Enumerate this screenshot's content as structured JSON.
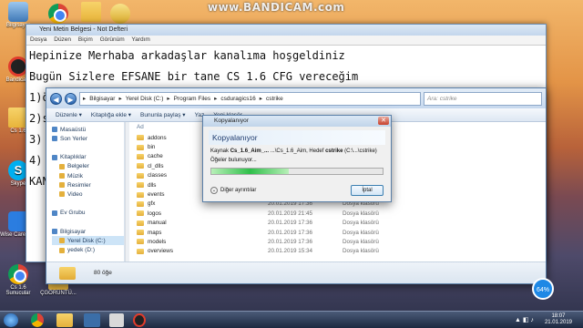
{
  "watermark": "www.BANDICAM.com",
  "desktop_icons": [
    {
      "label": "Bilgisayar"
    },
    {
      "label": "Bandica..."
    },
    {
      "label": "Cs 1.6"
    },
    {
      "label": "Skype"
    },
    {
      "label": "Wise Care 365"
    },
    {
      "label": "Cs 1.6 Sunucular"
    }
  ],
  "bottom_desk_label": "ÇGÖRÜNTÜ...",
  "notepad": {
    "title": "Yeni Metin Belgesi - Not Defteri",
    "menu": [
      "Dosya",
      "Düzen",
      "Biçim",
      "Görünüm",
      "Yardım"
    ],
    "lines": [
      "Hepinize Merhaba arkadaşlar kanalıma hoşgeldiniz",
      "",
      "Bugün Sizlere EFSANE bir tane CS 1.6 CFG vereceğim",
      "",
      "1)ö",
      "2)s",
      "3)",
      "4)",
      "",
      "KAN"
    ]
  },
  "explorer": {
    "breadcrumb": [
      "Bilgisayar",
      "Yerel Disk (C:)",
      "Program Files",
      "csduragics16",
      "cstrike"
    ],
    "search_placeholder": "Ara: cstrike",
    "toolbar": [
      "Düzenle ▾",
      "Kitaplığa ekle ▾",
      "Bununla paylaş ▾",
      "Yaz",
      "Yeni klasör"
    ],
    "nav": [
      {
        "label": "Masaüstü",
        "sub": false
      },
      {
        "label": "Son Yerler",
        "sub": false
      },
      {
        "label": "",
        "sub": false
      },
      {
        "label": "Kitaplıklar",
        "sub": false
      },
      {
        "label": "Belgeler",
        "sub": true
      },
      {
        "label": "Müzik",
        "sub": true
      },
      {
        "label": "Resimler",
        "sub": true
      },
      {
        "label": "Video",
        "sub": true
      },
      {
        "label": "",
        "sub": false
      },
      {
        "label": "Ev Grubu",
        "sub": false
      },
      {
        "label": "",
        "sub": false
      },
      {
        "label": "Bilgisayar",
        "sub": false
      },
      {
        "label": "Yerel Disk (C:)",
        "sub": true
      },
      {
        "label": "yedek (D:)",
        "sub": true
      }
    ],
    "column_header": "Ad",
    "files": [
      {
        "name": "addons",
        "date": "",
        "type": ""
      },
      {
        "name": "bin",
        "date": "",
        "type": ""
      },
      {
        "name": "cache",
        "date": "",
        "type": ""
      },
      {
        "name": "cl_dlls",
        "date": "",
        "type": ""
      },
      {
        "name": "classes",
        "date": "",
        "type": ""
      },
      {
        "name": "dlls",
        "date": "",
        "type": ""
      },
      {
        "name": "events",
        "date": "",
        "type": ""
      },
      {
        "name": "gfx",
        "date": "20.01.2019 17:36",
        "type": "Dosya klasörü"
      },
      {
        "name": "logos",
        "date": "20.01.2019 21:45",
        "type": "Dosya klasörü"
      },
      {
        "name": "manual",
        "date": "20.01.2019 17:36",
        "type": "Dosya klasörü"
      },
      {
        "name": "maps",
        "date": "20.01.2019 17:36",
        "type": "Dosya klasörü"
      },
      {
        "name": "models",
        "date": "20.01.2019 17:36",
        "type": "Dosya klasörü"
      },
      {
        "name": "overviews",
        "date": "20.01.2019 15:34",
        "type": "Dosya klasörü"
      }
    ],
    "status": "80 öğe"
  },
  "copy_dialog": {
    "title": "Kopyalanıyor",
    "header": "Kopyalanıyor",
    "source_prefix": "Kaynak",
    "source_name": "Cs_1.6_Aim_...",
    "source_path": "...\\Cs_1.6_Aim, Hedef",
    "dest_name": "cstrike",
    "dest_path": "(C:\\...\\cstrike)",
    "status_line": "Öğeler bulunuyor...",
    "progress": 0.45,
    "more_label": "Diğer ayrıntılar",
    "cancel_label": "İptal"
  },
  "progress_badge": "64%",
  "clock": {
    "time": "18:07",
    "date": "21.01.2019"
  }
}
